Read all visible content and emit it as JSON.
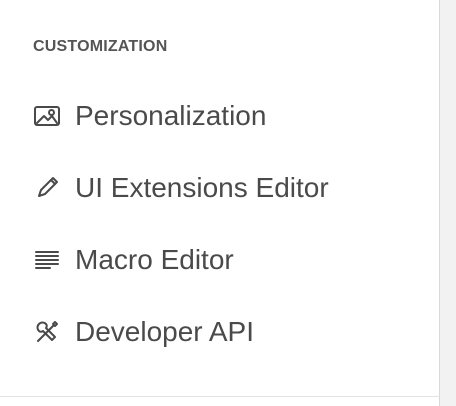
{
  "section": {
    "title": "CUSTOMIZATION"
  },
  "menu": {
    "items": [
      {
        "label": "Personalization",
        "icon": "image-icon"
      },
      {
        "label": "UI Extensions Editor",
        "icon": "pencil-icon"
      },
      {
        "label": "Macro Editor",
        "icon": "text-lines-icon"
      },
      {
        "label": "Developer API",
        "icon": "tools-icon"
      }
    ]
  },
  "colors": {
    "text": "#4a4a4a",
    "section_title": "#555555",
    "border": "#d9d9d9",
    "strip": "#f2f2f2"
  }
}
